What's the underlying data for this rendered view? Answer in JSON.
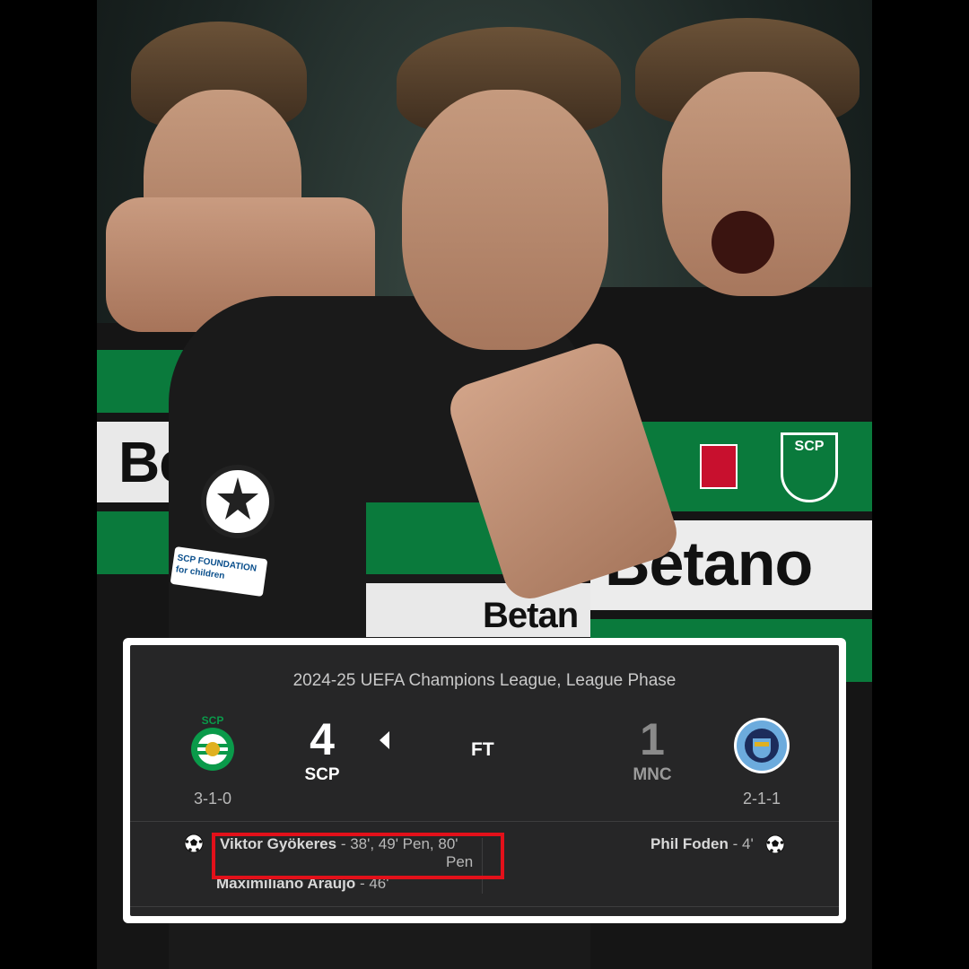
{
  "competition": "2024-25 UEFA Champions League, League Phase",
  "status": "FT",
  "home": {
    "abbr": "SCP",
    "score": "4",
    "record": "3-1-0",
    "logo_icon": "sporting-cp-crest-icon",
    "scorers": [
      {
        "name": "Viktor Gyökeres",
        "minutes_line1": " - 38', 49' Pen, 80'",
        "minutes_line2": "Pen"
      },
      {
        "name": "Maximiliano Araújo",
        "minutes_line1": " - 46'"
      }
    ]
  },
  "away": {
    "abbr": "MNC",
    "score": "1",
    "record": "2-1-1",
    "logo_icon": "manchester-city-crest-icon",
    "scorers": [
      {
        "name": "Phil Foden",
        "minutes_line1": " - 4'"
      }
    ]
  },
  "colors": {
    "card_bg": "#262627",
    "highlight": "#e3101a",
    "sporting_green": "#0a7a3c"
  },
  "photo": {
    "sponsor_left": "Bet",
    "sponsor_center": "Betan",
    "sponsor_right": "Betano",
    "crest_text": "SCP",
    "sleeve_badge": "SCP FOUNDATION for children"
  }
}
